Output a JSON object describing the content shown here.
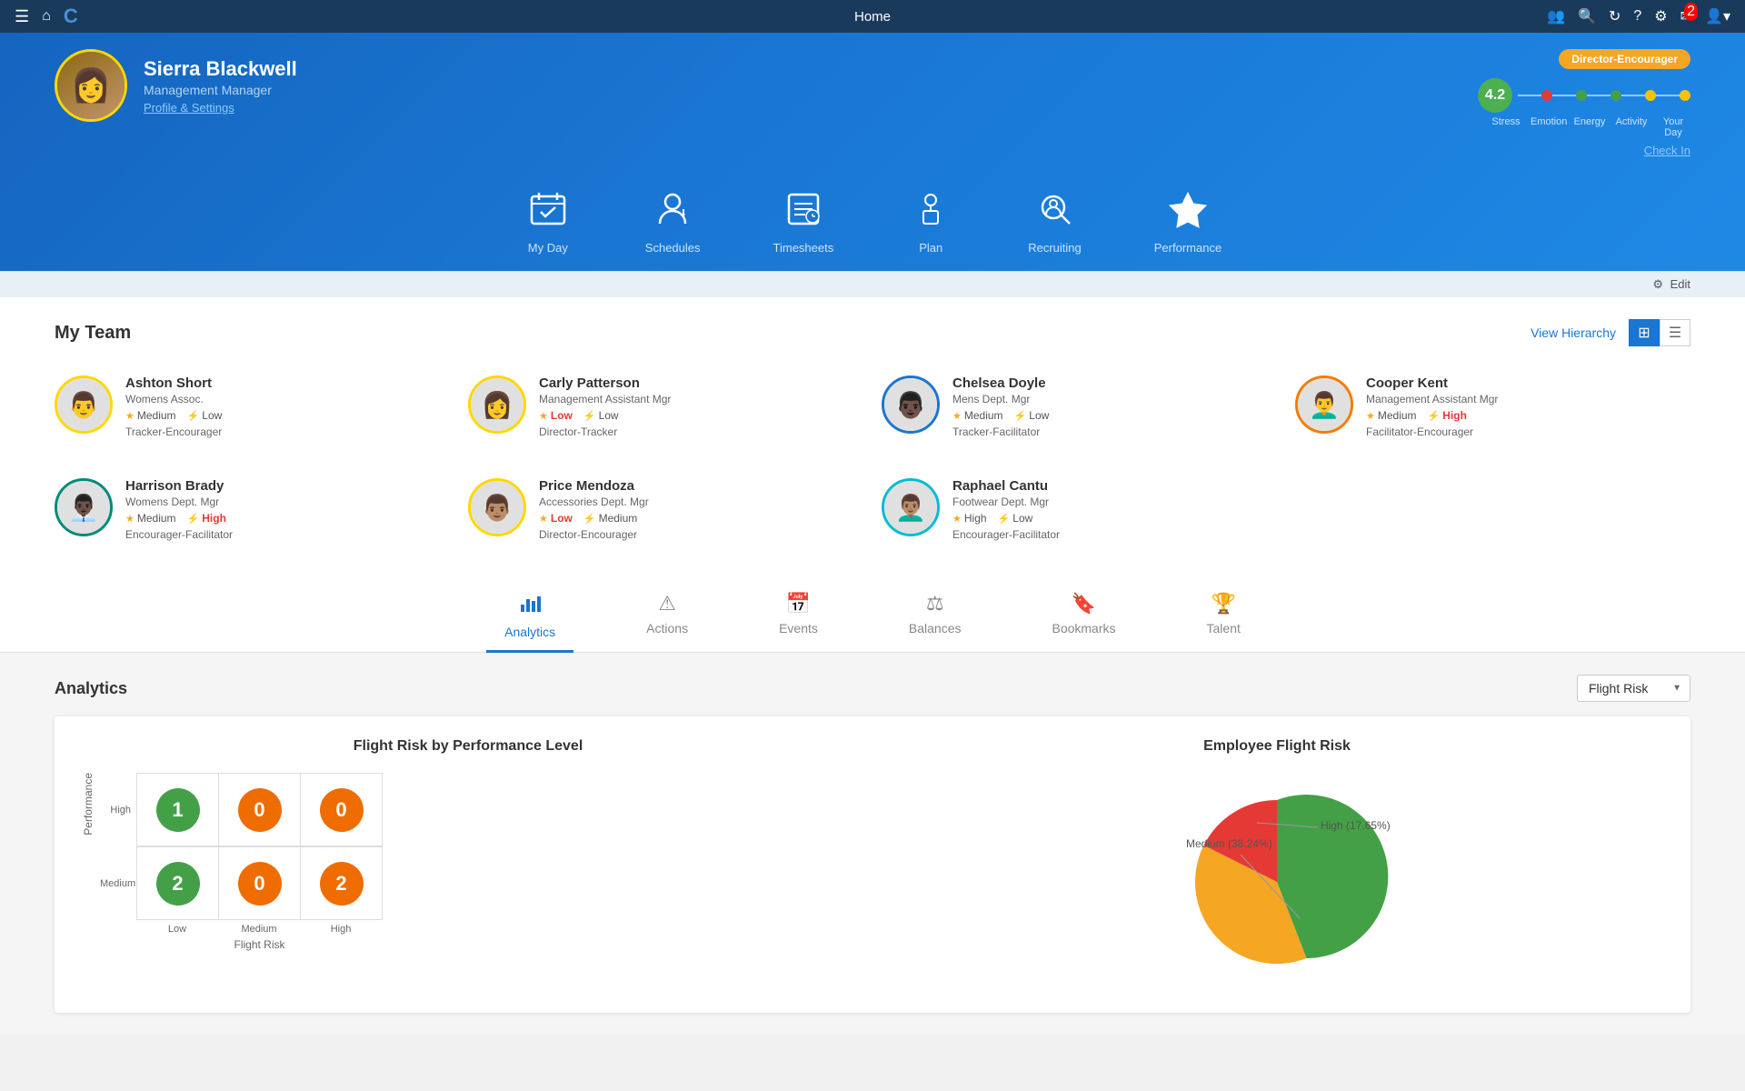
{
  "topNav": {
    "title": "Home",
    "hamburger": "☰",
    "homeIcon": "⌂",
    "logo": "C",
    "icons": [
      "👤👤",
      "🔍",
      "↻",
      "?",
      "⚙",
      "✉",
      "👤"
    ],
    "notifCount": "2"
  },
  "header": {
    "user": {
      "name": "Sierra Blackwell",
      "role": "Management Manager",
      "profileLink": "Profile & Settings"
    },
    "badge": "Director-Encourager",
    "wellness": {
      "score": "4.2",
      "labels": [
        "Stress",
        "Emotion",
        "Energy",
        "Activity",
        "Your Day"
      ]
    },
    "checkIn": "Check In"
  },
  "navItems": [
    {
      "icon": "☑",
      "label": "My Day"
    },
    {
      "icon": "👤⏰",
      "label": "Schedules"
    },
    {
      "icon": "📋",
      "label": "Timesheets"
    },
    {
      "icon": "🧍",
      "label": "Plan"
    },
    {
      "icon": "🔍👤",
      "label": "Recruiting"
    },
    {
      "icon": "★",
      "label": "Performance"
    }
  ],
  "edit": "Edit",
  "myTeam": {
    "title": "My Team",
    "viewHierarchy": "View Hierarchy",
    "members": [
      {
        "name": "Ashton Short",
        "role": "Womens Assoc.",
        "stress": "Medium",
        "energy": "Low",
        "tags": "Tracker-Encourager",
        "borderColor": "border-gold"
      },
      {
        "name": "Carly Patterson",
        "role": "Management Assistant Mgr",
        "stress": "Low",
        "stressClass": "red",
        "energy": "Low",
        "tags": "Director-Tracker",
        "borderColor": "border-gold"
      },
      {
        "name": "Chelsea Doyle",
        "role": "Mens Dept. Mgr",
        "stress": "Medium",
        "energy": "Low",
        "tags": "Tracker-Facilitator",
        "borderColor": "border-blue"
      },
      {
        "name": "Cooper Kent",
        "role": "Management Assistant Mgr",
        "stress": "Medium",
        "energy": "High",
        "energyClass": "red",
        "tags": "Facilitator-Encourager",
        "borderColor": "border-orange"
      },
      {
        "name": "Harrison Brady",
        "role": "Womens Dept. Mgr",
        "stress": "Medium",
        "energy": "High",
        "energyClass": "red",
        "tags": "Encourager-Facilitator",
        "borderColor": "border-teal"
      },
      {
        "name": "Price Mendoza",
        "role": "Accessories Dept. Mgr",
        "stress": "Low",
        "stressClass": "red",
        "energy": "Medium",
        "tags": "Director-Encourager",
        "borderColor": "border-gold"
      },
      {
        "name": "Raphael Cantu",
        "role": "Footwear Dept. Mgr",
        "stress": "High",
        "energy": "Low",
        "tags": "Encourager-Facilitator",
        "borderColor": "border-cyan"
      }
    ]
  },
  "tabs": [
    {
      "icon": "📊",
      "label": "Analytics",
      "active": true
    },
    {
      "icon": "⚠",
      "label": "Actions",
      "active": false
    },
    {
      "icon": "📅",
      "label": "Events",
      "active": false
    },
    {
      "icon": "⚖",
      "label": "Balances",
      "active": false
    },
    {
      "icon": "🔖",
      "label": "Bookmarks",
      "active": false
    },
    {
      "icon": "🏆",
      "label": "Talent",
      "active": false
    }
  ],
  "analytics": {
    "title": "Analytics",
    "dropdown": "Flight Risk",
    "chart1Title": "Flight Risk by Performance Level",
    "chart2Title": "Employee Flight Risk",
    "xAxisLabels": [
      "Low",
      "Medium",
      "High"
    ],
    "xAxisTitle": "Flight Risk",
    "yAxisTitle": "Performance",
    "yLabels": [
      "High",
      "Medium"
    ],
    "cells": [
      [
        {
          "val": "1",
          "type": "green"
        },
        {
          "val": "0",
          "type": "orange"
        },
        {
          "val": "0",
          "type": "orange"
        }
      ],
      [
        {
          "val": "2",
          "type": "green"
        },
        {
          "val": "0",
          "type": "orange"
        },
        {
          "val": "2",
          "type": "orange"
        }
      ]
    ],
    "pieLabels": [
      {
        "text": "Medium (38.24%)",
        "position": "medium"
      },
      {
        "text": "High (17.65%)",
        "position": "high"
      }
    ]
  }
}
